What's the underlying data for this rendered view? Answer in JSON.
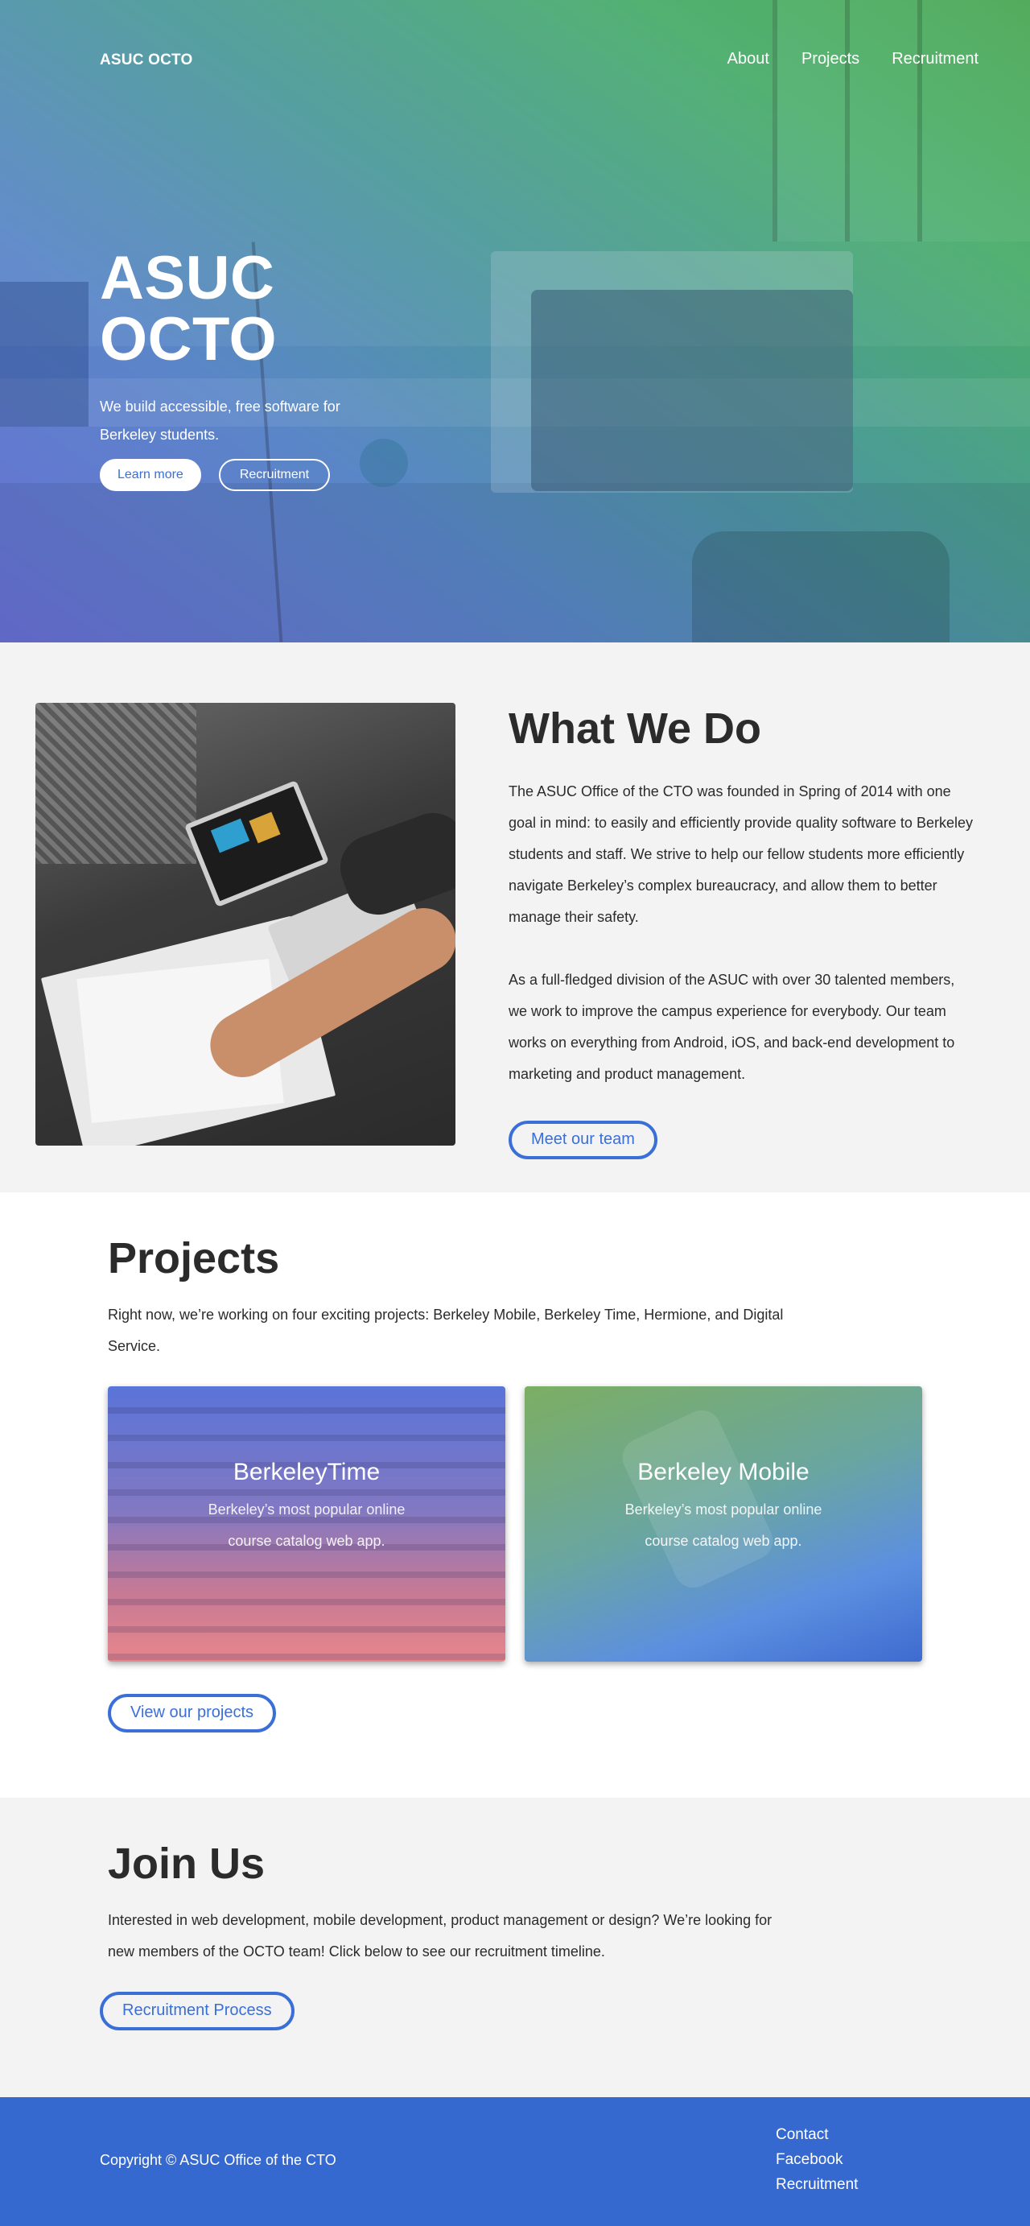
{
  "nav": {
    "brand": "ASUC OCTO",
    "links": [
      "About",
      "Projects",
      "Recruitment"
    ]
  },
  "hero": {
    "title": "ASUC OCTO",
    "subtitle": "We build accessible, free software for Berkeley students.",
    "primary_button": "Learn more",
    "secondary_button": "Recruitment"
  },
  "what": {
    "title": "What We Do",
    "paragraph1": "The ASUC Office of the CTO was founded in Spring of 2014 with one goal in mind: to easily and efficiently provide quality software to Berkeley students and staff. We strive to help our fellow students more efficiently navigate Berkeley’s complex bureaucracy, and allow them to better manage their safety.",
    "paragraph2": "As a full-fledged division of the ASUC with over 30 talented members, we work to improve the campus experience for everybody. Our team works on everything from Android, iOS, and back-end development to marketing and product management.",
    "button": "Meet our team"
  },
  "projects": {
    "title": "Projects",
    "intro": "Right now, we’re working on four exciting projects: Berkeley Mobile, Berkeley Time, Hermione, and Digital Service.",
    "cards": [
      {
        "title": "BerkeleyTime",
        "description": "Berkeley’s most popular online course catalog web app."
      },
      {
        "title": "Berkeley Mobile",
        "description": "Berkeley’s most popular online course catalog web app."
      }
    ],
    "button": "View our projects"
  },
  "join": {
    "title": "Join Us",
    "text": "Interested in web development, mobile development, product management or design? We’re looking for new members of the OCTO team! Click below to see our recruitment timeline.",
    "button": "Recruitment Process"
  },
  "footer": {
    "copyright": "Copyright © ASUC Office of the CTO",
    "links": [
      "Contact",
      "Facebook",
      "Recruitment"
    ]
  },
  "colors": {
    "accent": "#3a6fd8",
    "footer_bg": "#3669cf",
    "text": "#2b2b2b",
    "section_bg": "#f3f3f3"
  }
}
